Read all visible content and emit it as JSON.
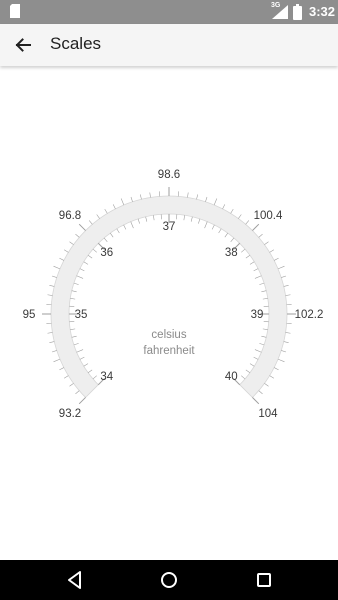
{
  "status_bar": {
    "network_label": "3G",
    "time": "3:32",
    "icons": [
      "sim-card-icon",
      "cell-signal-icon",
      "battery-icon"
    ]
  },
  "app_bar": {
    "title": "Scales",
    "back_icon": "arrow-back-icon"
  },
  "gauge": {
    "outer_scale": {
      "unit": "fahrenheit",
      "min": 93.2,
      "max": 104,
      "labels": [
        "93.2",
        "95",
        "96.8",
        "98.6",
        "100.4",
        "102.2",
        "104"
      ]
    },
    "inner_scale": {
      "unit": "celsius",
      "min": 34,
      "max": 40,
      "labels": [
        "34",
        "35",
        "36",
        "37",
        "38",
        "39",
        "40"
      ]
    },
    "center_labels": {
      "line1": "celsius",
      "line2": "fahrenheit"
    },
    "colors": {
      "band": "#eeeeee",
      "tick": "#9e9e9e",
      "label": "#3a3a3a",
      "center_label": "#8a8a8a"
    }
  },
  "nav_bar": {
    "buttons": [
      "nav-back-icon",
      "nav-home-icon",
      "nav-recents-icon"
    ]
  }
}
